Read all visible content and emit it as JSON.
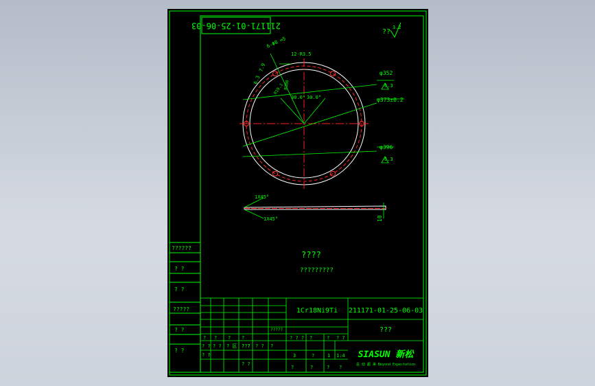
{
  "drawing_number": "211171-01-25-06-03",
  "drawing_number_title": "211171-01-25-06-03",
  "roughness_general": {
    "label": "??",
    "value": "3.2"
  },
  "dims": {
    "holes": "6-Φ8 ∞5",
    "slots": "12-R3.5",
    "chamfer1": "R19.1",
    "chamfer2": "R380",
    "angle1": "30.0°",
    "angle2": "30.0°",
    "small_a": "6.3",
    "small_b": "7.9",
    "d352": "φ352",
    "d352_rough": "6.3",
    "d373": "φ373±0.2",
    "d396": "φ396",
    "d396_rough": "6.3",
    "chamfer_top": "1X45°",
    "chamfer_bottom": "1X45°",
    "thickness": "10"
  },
  "notes": {
    "title": "????",
    "body": "?????????"
  },
  "left_table": [
    "??????",
    "?  ?",
    "?  ?",
    "?????",
    "?  ?",
    "?  ?"
  ],
  "title_block": {
    "material": "1Cr18Ni9Ti",
    "drawing_no": "211171-01-25-06-03",
    "name": "???",
    "logo_main": "SIASUN 新松",
    "logo_sub": "总 动 超 来   Beyond Expectation",
    "row_labels_a": [
      "?",
      "?",
      "?",
      "?",
      "?????",
      "?"
    ],
    "row_labels_b": [
      "? ?",
      "? ?",
      "? 区",
      "? ?",
      "? ?",
      "?"
    ],
    "row_labels_c": [
      "? ?",
      "? ?",
      "? ?"
    ],
    "weight_row": [
      "? ? ?",
      "?",
      "?",
      "? ?"
    ],
    "scale_row": [
      "3",
      "?",
      "1",
      "1:4"
    ],
    "sheet_row": [
      "?",
      "?",
      "?",
      "?"
    ],
    "label_sj": "???",
    "label_sh": "? ?",
    "label_gy": "? ?"
  },
  "colors": {
    "frame": "#00ff00",
    "circle": "#ffffff",
    "center": "#ff2020",
    "hole": "#ff3030",
    "dim": "#00ff00",
    "text": "#00ff00",
    "bg": "#000000"
  }
}
